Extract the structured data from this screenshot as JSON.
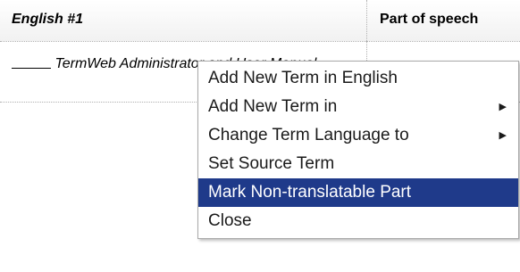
{
  "table": {
    "headers": {
      "english": "English #1",
      "part_of_speech": "Part of speech"
    },
    "row": {
      "term_blank": "____",
      "term_text": " TermWeb Administrator and User Manual"
    }
  },
  "context_menu": {
    "items": [
      {
        "label": "Add New Term in English",
        "has_submenu": false,
        "highlighted": false
      },
      {
        "label": "Add New Term in",
        "has_submenu": true,
        "highlighted": false
      },
      {
        "label": "Change Term Language to",
        "has_submenu": true,
        "highlighted": false
      },
      {
        "label": "Set Source Term",
        "has_submenu": false,
        "highlighted": false
      },
      {
        "label": "Mark Non-translatable Part",
        "has_submenu": false,
        "highlighted": true
      },
      {
        "label": "Close",
        "has_submenu": false,
        "highlighted": false
      }
    ],
    "submenu_arrow_icon": "triangle-right-icon",
    "highlight_color": "#1f3a8a"
  }
}
